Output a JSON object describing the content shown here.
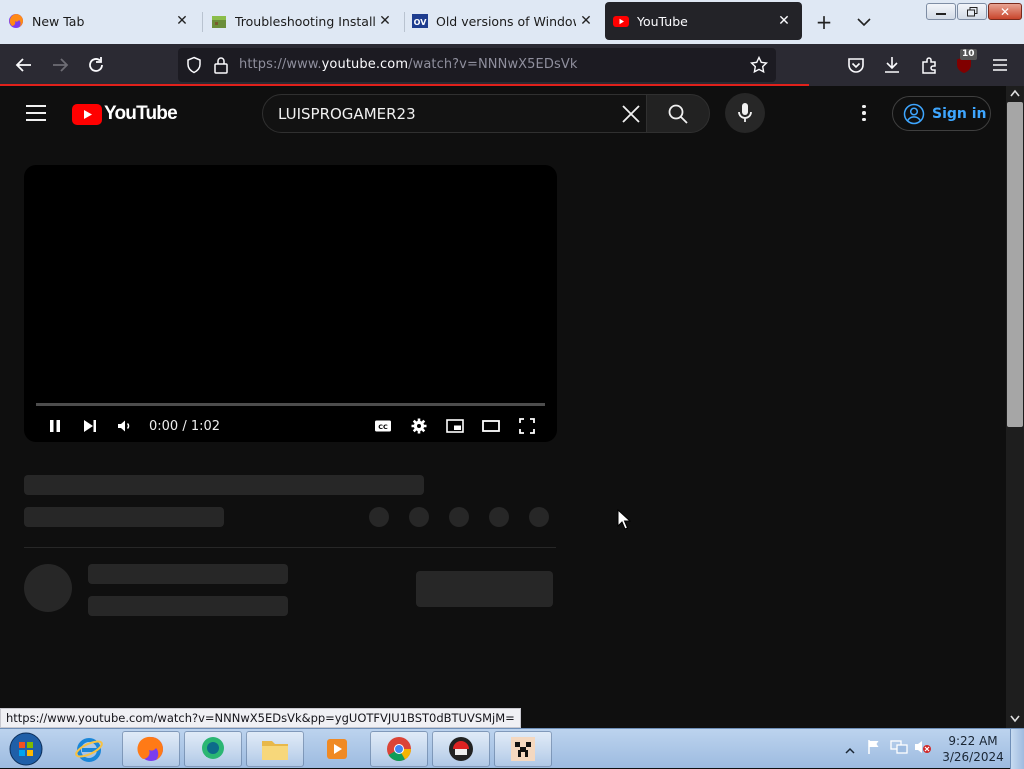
{
  "browser": {
    "tabs": [
      {
        "title": "New Tab",
        "active": false
      },
      {
        "title": "Troubleshooting Installing",
        "active": false
      },
      {
        "title": "Old versions of Windows, I",
        "active": false
      },
      {
        "title": "YouTube",
        "active": true
      }
    ],
    "url_prefix": "https://www.",
    "url_domain": "youtube.com",
    "url_path": "/watch?v=NNNwX5EDsVk",
    "extension_badge": "10",
    "page_load_progress": 0.79
  },
  "youtube": {
    "logo_text": "YouTube",
    "search_value": "LUISPROGAMER23",
    "sign_in_label": "Sign in"
  },
  "player": {
    "time": "0:00 / 1:02",
    "progress_fraction": 0.0
  },
  "status_bar": {
    "url": "https://www.youtube.com/watch?v=NNNwX5EDsVk&pp=ygUOTFVJU1BST0dBTUVSMjM="
  },
  "taskbar": {
    "time": "9:22 AM",
    "date": "3/26/2024"
  },
  "colors": {
    "yt_red": "#ff0000",
    "link_blue": "#3ea6ff",
    "load_bar": "#e0211b"
  }
}
